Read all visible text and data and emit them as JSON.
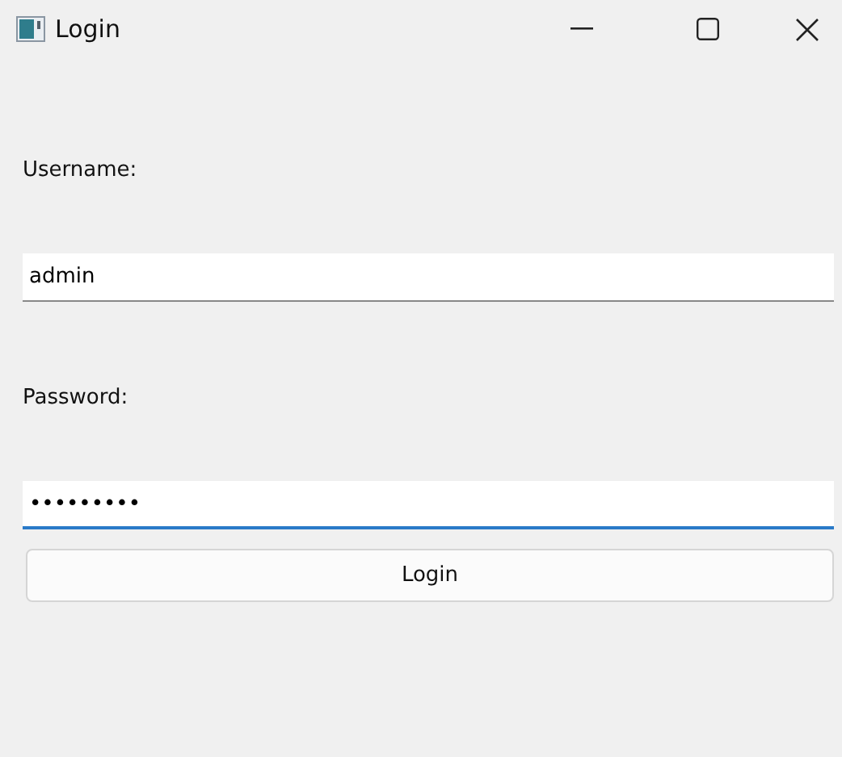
{
  "window": {
    "title": "Login"
  },
  "fields": [
    {
      "label": "Username:",
      "value": "admin",
      "focused": false
    },
    {
      "label": "Password:",
      "value": "•••••••••",
      "focused": true
    }
  ],
  "buttons": [
    {
      "label": "Login"
    }
  ]
}
